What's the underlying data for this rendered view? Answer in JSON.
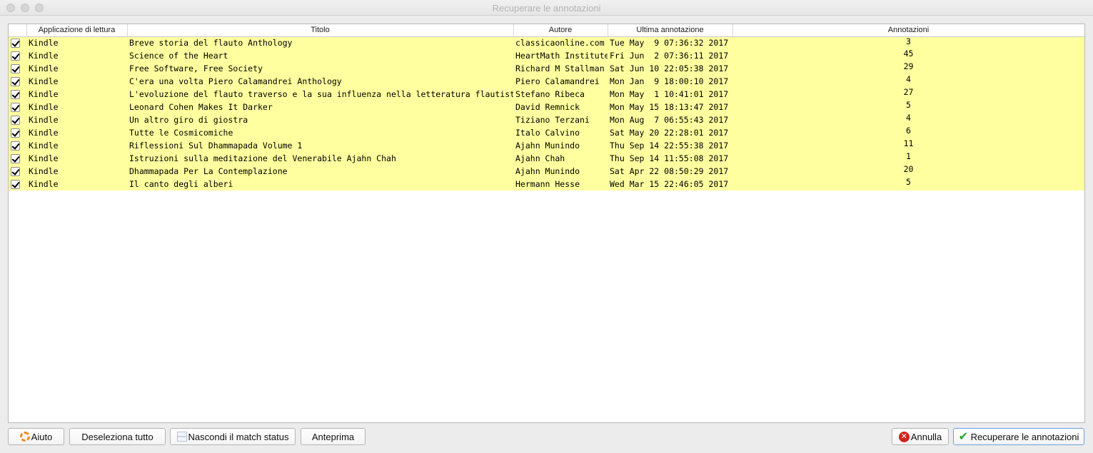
{
  "window": {
    "title": "Recuperare le annotazioni"
  },
  "table": {
    "columns": [
      "",
      "Applicazione di lettura",
      "Titolo",
      "Autore",
      "Ultima annotazione",
      "Annotazioni"
    ],
    "rows": [
      {
        "checked": true,
        "app": "Kindle",
        "title": "Breve storia del flauto Anthology",
        "author": "classicaonline.com",
        "last": "Tue May  9 07:36:32 2017",
        "count": "3"
      },
      {
        "checked": true,
        "app": "Kindle",
        "title": "Science of the Heart",
        "author": "HeartMath Institute",
        "last": "Fri Jun  2 07:36:11 2017",
        "count": "45"
      },
      {
        "checked": true,
        "app": "Kindle",
        "title": "Free Software, Free Society",
        "author": "Richard M Stallman",
        "last": "Sat Jun 10 22:05:38 2017",
        "count": "29"
      },
      {
        "checked": true,
        "app": "Kindle",
        "title": "C'era una volta Piero Calamandrei Anthology",
        "author": "Piero Calamandrei",
        "last": "Mon Jan  9 18:00:10 2017",
        "count": "4"
      },
      {
        "checked": true,
        "app": "Kindle",
        "title": "L'evoluzione del flauto traverso e la sua influenza nella letteratura flautistica",
        "author": "Stefano Ribeca",
        "last": "Mon May  1 10:41:01 2017",
        "count": "27"
      },
      {
        "checked": true,
        "app": "Kindle",
        "title": "Leonard Cohen Makes It Darker",
        "author": "David Remnick",
        "last": "Mon May 15 18:13:47 2017",
        "count": "5"
      },
      {
        "checked": true,
        "app": "Kindle",
        "title": "Un altro giro di giostra",
        "author": "Tiziano Terzani",
        "last": "Mon Aug  7 06:55:43 2017",
        "count": "4"
      },
      {
        "checked": true,
        "app": "Kindle",
        "title": "Tutte le Cosmicomiche",
        "author": "Italo Calvino",
        "last": "Sat May 20 22:28:01 2017",
        "count": "6"
      },
      {
        "checked": true,
        "app": "Kindle",
        "title": "Riflessioni Sul Dhammapada Volume 1",
        "author": "Ajahn Munindo",
        "last": "Thu Sep 14 22:55:38 2017",
        "count": "11"
      },
      {
        "checked": true,
        "app": "Kindle",
        "title": "Istruzioni sulla meditazione del Venerabile Ajahn Chah",
        "author": "Ajahn Chah",
        "last": "Thu Sep 14 11:55:08 2017",
        "count": "1"
      },
      {
        "checked": true,
        "app": "Kindle",
        "title": "Dhammapada Per La Contemplazione",
        "author": "Ajahn Munindo",
        "last": "Sat Apr 22 08:50:29 2017",
        "count": "20"
      },
      {
        "checked": true,
        "app": "Kindle",
        "title": "Il canto degli alberi",
        "author": "Hermann Hesse",
        "last": "Wed Mar 15 22:46:05 2017",
        "count": "5"
      }
    ],
    "row_highlight_color": "#ffff9f"
  },
  "buttons": {
    "help": "Aiuto",
    "deselect_all": "Deseleziona tutto",
    "hide_match": "Nascondi il match status",
    "preview": "Anteprima",
    "cancel": "Annulla",
    "fetch": "Recuperare le annotazioni"
  },
  "icons": {
    "help": "lifebuoy-icon",
    "hide_match": "toggle-icon",
    "cancel": "cancel-x-icon",
    "fetch": "checkmark-icon"
  }
}
